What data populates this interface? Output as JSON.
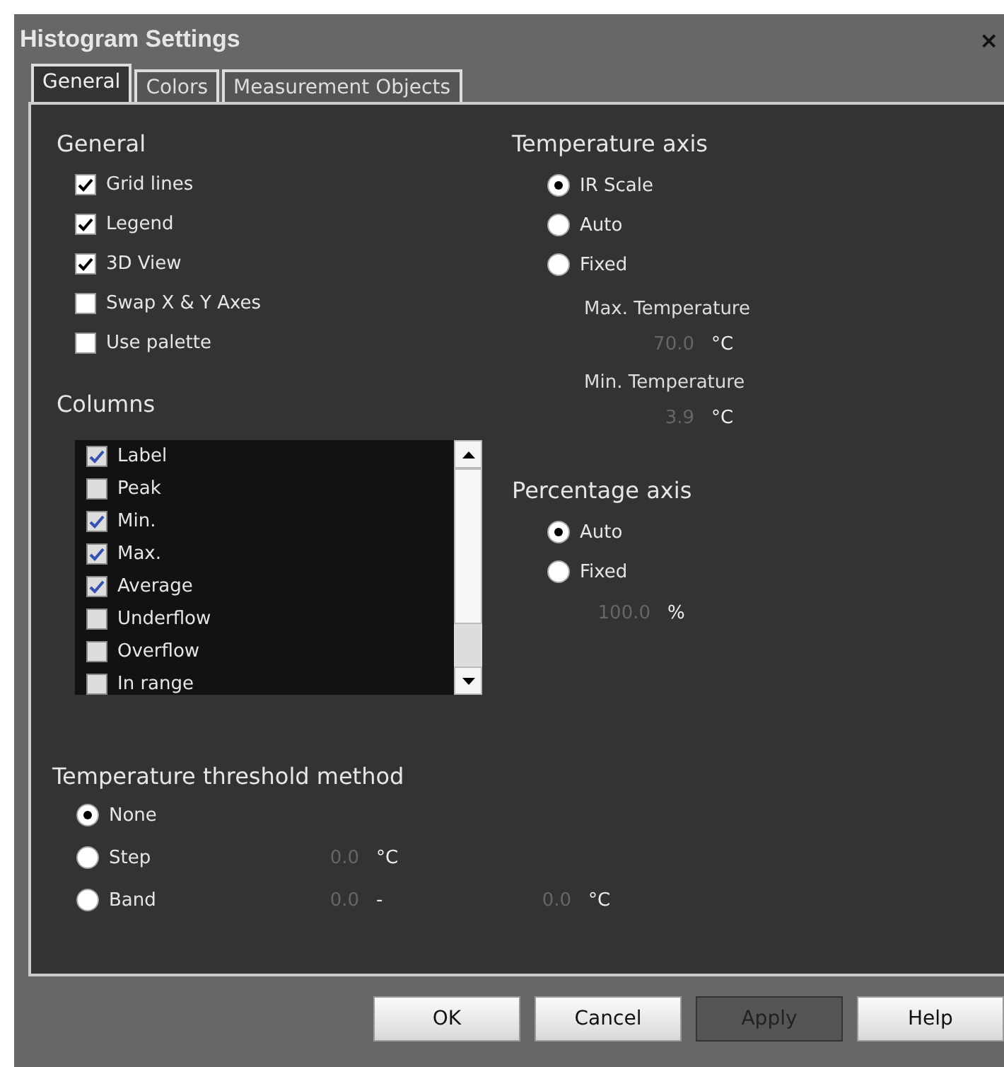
{
  "window": {
    "title": "Histogram Settings",
    "close": "×"
  },
  "tabs": [
    {
      "label": "General",
      "selected": true
    },
    {
      "label": "Colors",
      "selected": false
    },
    {
      "label": "Measurement Objects",
      "selected": false
    }
  ],
  "general": {
    "heading": "General",
    "options": [
      {
        "label": "Grid lines",
        "checked": true
      },
      {
        "label": "Legend",
        "checked": true
      },
      {
        "label": "3D View",
        "checked": true
      },
      {
        "label": "Swap X & Y Axes",
        "checked": false
      },
      {
        "label": "Use palette",
        "checked": false
      }
    ]
  },
  "columns": {
    "heading": "Columns",
    "items": [
      {
        "label": "Label",
        "checked": true
      },
      {
        "label": "Peak",
        "checked": false
      },
      {
        "label": "Min.",
        "checked": true
      },
      {
        "label": "Max.",
        "checked": true
      },
      {
        "label": "Average",
        "checked": true
      },
      {
        "label": "Underflow",
        "checked": false
      },
      {
        "label": "Overflow",
        "checked": false
      },
      {
        "label": "In range",
        "checked": false
      }
    ]
  },
  "temperature_axis": {
    "heading": "Temperature axis",
    "options": [
      {
        "label": "IR Scale",
        "selected": true
      },
      {
        "label": "Auto",
        "selected": false
      },
      {
        "label": "Fixed",
        "selected": false
      }
    ],
    "fields": [
      {
        "label": "Max. Temperature",
        "value": "70.0",
        "unit": "°C",
        "disabled": true
      },
      {
        "label": "Min. Temperature",
        "value": "3.9",
        "unit": "°C",
        "disabled": true
      }
    ]
  },
  "percentage_axis": {
    "heading": "Percentage axis",
    "options": [
      {
        "label": "Auto",
        "selected": true
      },
      {
        "label": "Fixed",
        "selected": false
      }
    ],
    "field": {
      "value": "100.0",
      "unit": "%",
      "disabled": true
    }
  },
  "threshold": {
    "heading": "Temperature threshold method",
    "options": [
      {
        "label": "None",
        "selected": true
      },
      {
        "label": "Step",
        "selected": false,
        "fields": [
          {
            "value": "0.0",
            "unit": "°C",
            "disabled": true
          }
        ]
      },
      {
        "label": "Band",
        "selected": false,
        "fields": [
          {
            "value": "0.0",
            "unit": "-",
            "disabled": true
          },
          {
            "value": "0.0",
            "unit": "°C",
            "disabled": true
          }
        ]
      }
    ]
  },
  "buttons": [
    {
      "label": "OK",
      "disabled": false
    },
    {
      "label": "Cancel",
      "disabled": false
    },
    {
      "label": "Apply",
      "disabled": true
    },
    {
      "label": "Help",
      "disabled": false
    }
  ]
}
